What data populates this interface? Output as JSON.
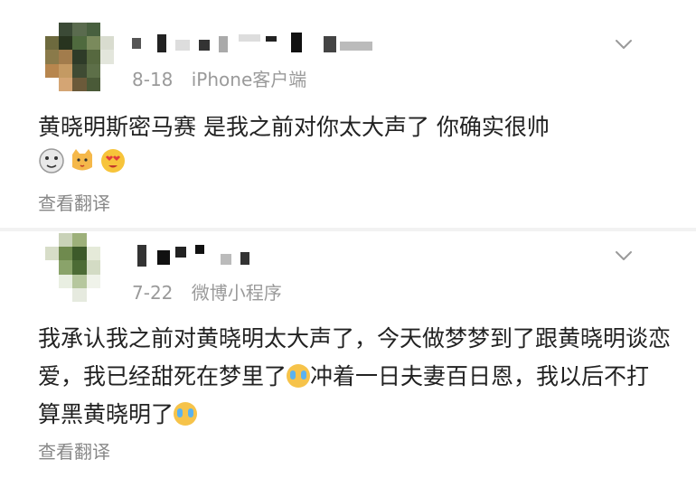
{
  "posts": [
    {
      "date": "8-18",
      "source": "iPhone客户端",
      "content": "黄晓明斯密马赛 是我之前对你太大声了 你确实很帅",
      "emojis": [
        "doge-icon",
        "cat-kiss-icon",
        "heart-eyes-icon"
      ],
      "translate_label": "查看翻译"
    },
    {
      "date": "7-22",
      "source": "微博小程序",
      "content_parts": [
        "我承认我之前对黄晓明太大声了，今天做梦梦到了跟黄晓明谈恋爱，我已经甜死在梦里了",
        "冲着一日夫妻百日恩，我以后不打算黑黄晓明了"
      ],
      "emojis": [
        "crying-icon",
        "crying-icon"
      ],
      "translate_label": "查看翻译"
    }
  ],
  "colors": {
    "text": "#222222",
    "meta": "#9a9a9a",
    "divider": "#f2f2f2"
  }
}
